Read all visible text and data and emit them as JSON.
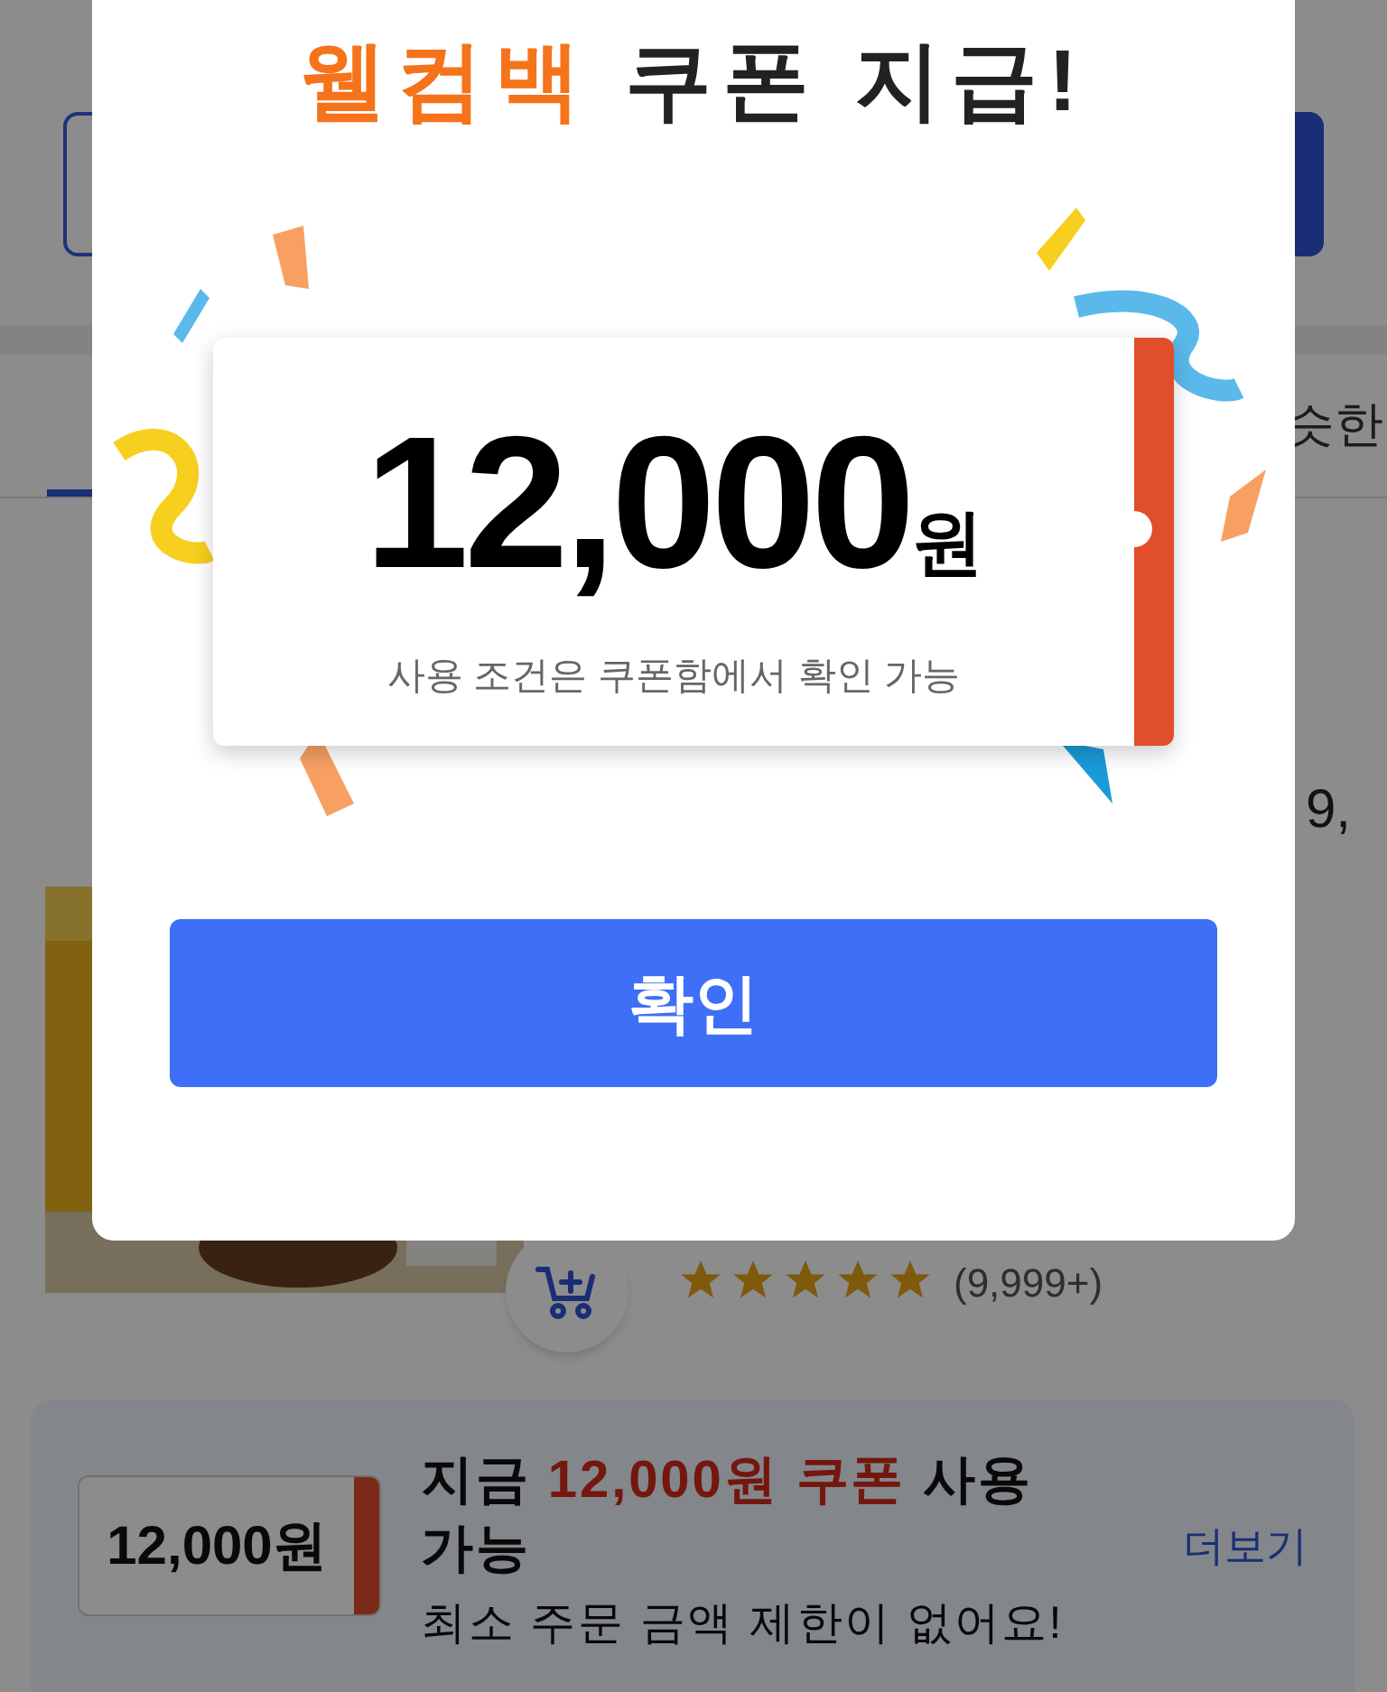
{
  "page": {
    "tab_partial": "슷한",
    "price_partial": "9,",
    "rating": {
      "stars": 5,
      "count": "(9,999+)"
    },
    "coupon_banner": {
      "ticket_amount": "12,000원",
      "headline": [
        {
          "text": "지금 ",
          "highlight": false
        },
        {
          "text": "12,000원 쿠폰",
          "highlight": true
        },
        {
          "text": " 사용 가능",
          "highlight": false
        }
      ],
      "more_link": "더보기",
      "note": "최소 주문 금액 제한이 없어요!"
    }
  },
  "modal": {
    "title": [
      {
        "text": "웰컴백",
        "highlight": true
      },
      {
        "text": " 쿠폰 지급!",
        "highlight": false
      }
    ],
    "coupon": {
      "amount": "12,000",
      "currency": "원",
      "condition": "사용 조건은 쿠폰함에서 확인 가능"
    },
    "confirm_button": "확인"
  }
}
